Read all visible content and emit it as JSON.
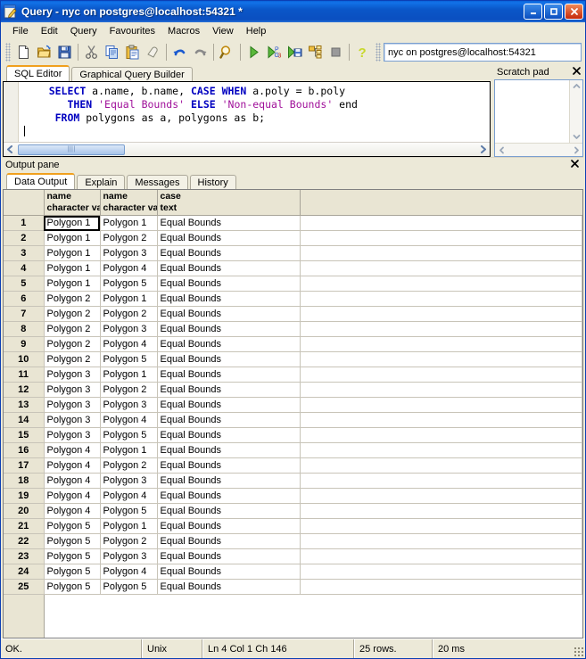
{
  "window": {
    "title": "Query - nyc on postgres@localhost:54321 *",
    "icon": "query-editor-icon",
    "controls": {
      "minimize": "_",
      "maximize": "□",
      "close": "✕"
    }
  },
  "menu": {
    "items": [
      "File",
      "Edit",
      "Query",
      "Favourites",
      "Macros",
      "View",
      "Help"
    ]
  },
  "toolbar": {
    "icons": [
      "new-file-icon",
      "open-file-icon",
      "save-file-icon",
      "cut-icon",
      "copy-icon",
      "paste-icon",
      "clear-icon",
      "undo-icon",
      "redo-icon",
      "find-icon",
      "execute-query-icon",
      "explain-query-icon",
      "execute-to-file-icon",
      "explain-analyze-icon",
      "stop-query-icon",
      "help-icon"
    ],
    "connection": "nyc on postgres@localhost:54321"
  },
  "editor": {
    "tabs": [
      {
        "label": "SQL Editor",
        "active": true
      },
      {
        "label": "Graphical Query Builder",
        "active": false
      }
    ],
    "sql_lines": [
      "    SELECT a.name, b.name, CASE WHEN a.poly = b.poly",
      "       THEN 'Equal Bounds' ELSE 'Non-equal Bounds' end",
      "     FROM polygons as a, polygons as b;"
    ],
    "scrollbar": {
      "left_arrow": "◀",
      "right_arrow": "▶"
    }
  },
  "scratchpad": {
    "title": "Scratch pad",
    "close": "✕",
    "content": "",
    "up_arrow": "▲",
    "down_arrow": "▼",
    "left_arrow": "◀",
    "right_arrow": "▶"
  },
  "output": {
    "header": "Output pane",
    "close": "✕",
    "tabs": [
      {
        "label": "Data Output",
        "active": true
      },
      {
        "label": "Explain",
        "active": false
      },
      {
        "label": "Messages",
        "active": false
      },
      {
        "label": "History",
        "active": false
      }
    ],
    "columns": [
      {
        "name": "",
        "type": ""
      },
      {
        "name": "name",
        "type": "character var"
      },
      {
        "name": "name",
        "type": "character var"
      },
      {
        "name": "case",
        "type": "text"
      }
    ],
    "rows": [
      {
        "n": "1",
        "a": "Polygon 1",
        "b": "Polygon 1",
        "c": "Equal Bounds"
      },
      {
        "n": "2",
        "a": "Polygon 1",
        "b": "Polygon 2",
        "c": "Equal Bounds"
      },
      {
        "n": "3",
        "a": "Polygon 1",
        "b": "Polygon 3",
        "c": "Equal Bounds"
      },
      {
        "n": "4",
        "a": "Polygon 1",
        "b": "Polygon 4",
        "c": "Equal Bounds"
      },
      {
        "n": "5",
        "a": "Polygon 1",
        "b": "Polygon 5",
        "c": "Equal Bounds"
      },
      {
        "n": "6",
        "a": "Polygon 2",
        "b": "Polygon 1",
        "c": "Equal Bounds"
      },
      {
        "n": "7",
        "a": "Polygon 2",
        "b": "Polygon 2",
        "c": "Equal Bounds"
      },
      {
        "n": "8",
        "a": "Polygon 2",
        "b": "Polygon 3",
        "c": "Equal Bounds"
      },
      {
        "n": "9",
        "a": "Polygon 2",
        "b": "Polygon 4",
        "c": "Equal Bounds"
      },
      {
        "n": "10",
        "a": "Polygon 2",
        "b": "Polygon 5",
        "c": "Equal Bounds"
      },
      {
        "n": "11",
        "a": "Polygon 3",
        "b": "Polygon 1",
        "c": "Equal Bounds"
      },
      {
        "n": "12",
        "a": "Polygon 3",
        "b": "Polygon 2",
        "c": "Equal Bounds"
      },
      {
        "n": "13",
        "a": "Polygon 3",
        "b": "Polygon 3",
        "c": "Equal Bounds"
      },
      {
        "n": "14",
        "a": "Polygon 3",
        "b": "Polygon 4",
        "c": "Equal Bounds"
      },
      {
        "n": "15",
        "a": "Polygon 3",
        "b": "Polygon 5",
        "c": "Equal Bounds"
      },
      {
        "n": "16",
        "a": "Polygon 4",
        "b": "Polygon 1",
        "c": "Equal Bounds"
      },
      {
        "n": "17",
        "a": "Polygon 4",
        "b": "Polygon 2",
        "c": "Equal Bounds"
      },
      {
        "n": "18",
        "a": "Polygon 4",
        "b": "Polygon 3",
        "c": "Equal Bounds"
      },
      {
        "n": "19",
        "a": "Polygon 4",
        "b": "Polygon 4",
        "c": "Equal Bounds"
      },
      {
        "n": "20",
        "a": "Polygon 4",
        "b": "Polygon 5",
        "c": "Equal Bounds"
      },
      {
        "n": "21",
        "a": "Polygon 5",
        "b": "Polygon 1",
        "c": "Equal Bounds"
      },
      {
        "n": "22",
        "a": "Polygon 5",
        "b": "Polygon 2",
        "c": "Equal Bounds"
      },
      {
        "n": "23",
        "a": "Polygon 5",
        "b": "Polygon 3",
        "c": "Equal Bounds"
      },
      {
        "n": "24",
        "a": "Polygon 5",
        "b": "Polygon 4",
        "c": "Equal Bounds"
      },
      {
        "n": "25",
        "a": "Polygon 5",
        "b": "Polygon 5",
        "c": "Equal Bounds"
      }
    ],
    "selected_cell": {
      "row": 1,
      "column": 1
    }
  },
  "status": {
    "message": "OK.",
    "line_ending": "Unix",
    "position": "Ln 4 Col 1 Ch 146",
    "rows": "25 rows.",
    "time": "20 ms"
  },
  "colors": {
    "title_blue": "#0a56c8",
    "face": "#ece9d8",
    "grid_header": "#e9e5d3",
    "tab_accent": "#f0a01e",
    "sql_keyword": "#0000c0",
    "sql_string": "#a0109a"
  }
}
